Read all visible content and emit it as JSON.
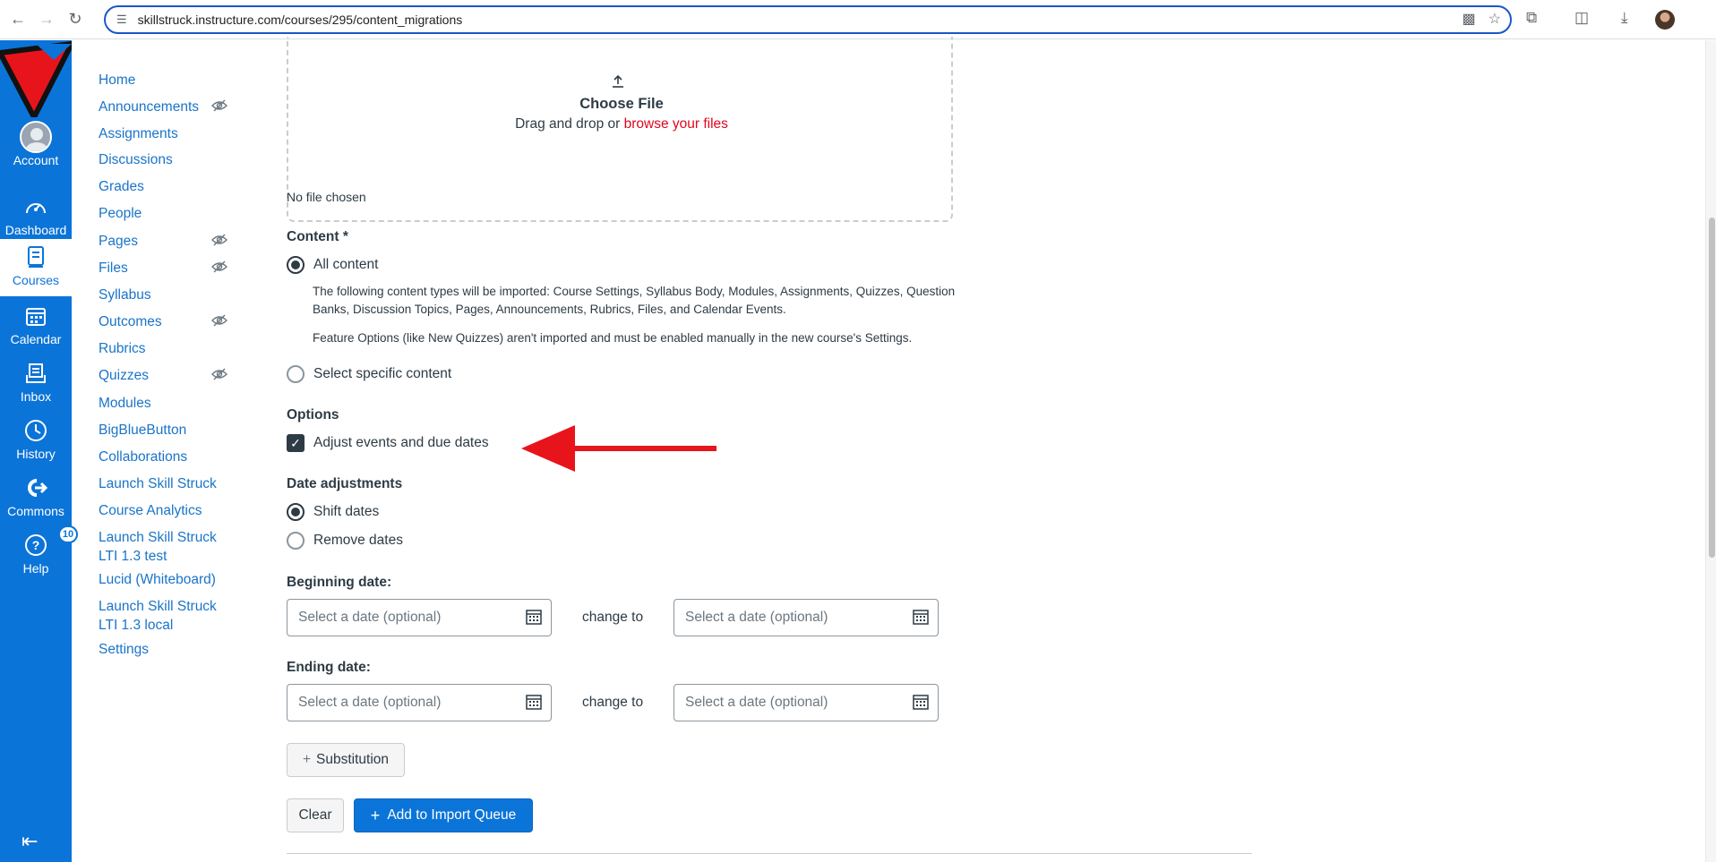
{
  "browser": {
    "url": "skillstruck.instructure.com/courses/295/content_migrations"
  },
  "global_nav": {
    "items": [
      {
        "label": "Account",
        "icon": "account-avatar"
      },
      {
        "label": "Dashboard",
        "icon": "dashboard-icon"
      },
      {
        "label": "Courses",
        "icon": "courses-icon",
        "active": true
      },
      {
        "label": "Calendar",
        "icon": "calendar-icon"
      },
      {
        "label": "Inbox",
        "icon": "inbox-icon"
      },
      {
        "label": "History",
        "icon": "history-icon"
      },
      {
        "label": "Commons",
        "icon": "commons-icon"
      },
      {
        "label": "Help",
        "icon": "help-icon",
        "badge": "10"
      }
    ],
    "accent": "#0b74d8"
  },
  "course_nav": {
    "items": [
      {
        "label": "Home",
        "hidden": false
      },
      {
        "label": "Announcements",
        "hidden": true
      },
      {
        "label": "Assignments",
        "hidden": false
      },
      {
        "label": "Discussions",
        "hidden": false
      },
      {
        "label": "Grades",
        "hidden": false
      },
      {
        "label": "People",
        "hidden": false
      },
      {
        "label": "Pages",
        "hidden": true
      },
      {
        "label": "Files",
        "hidden": true
      },
      {
        "label": "Syllabus",
        "hidden": false
      },
      {
        "label": "Outcomes",
        "hidden": true
      },
      {
        "label": "Rubrics",
        "hidden": false
      },
      {
        "label": "Quizzes",
        "hidden": true
      },
      {
        "label": "Modules",
        "hidden": false
      },
      {
        "label": "BigBlueButton",
        "hidden": false
      },
      {
        "label": "Collaborations",
        "hidden": false
      },
      {
        "label": "Launch Skill Struck",
        "hidden": false
      },
      {
        "label": "Course Analytics",
        "hidden": false
      },
      {
        "label": "Launch Skill Struck LTI 1.3 test",
        "hidden": false
      },
      {
        "label": "Lucid (Whiteboard)",
        "hidden": false
      },
      {
        "label": "Launch Skill Struck LTI 1.3 local",
        "hidden": false
      },
      {
        "label": "Settings",
        "hidden": false
      }
    ]
  },
  "upload": {
    "title": "Choose File",
    "sub_prefix": "Drag and drop or",
    "sub_link": "browse your files",
    "status": "No file chosen"
  },
  "content": {
    "label": "Content *",
    "all_content": "All content",
    "all_content_desc": "The following content types will be imported: Course Settings, Syllabus Body, Modules, Assignments, Quizzes, Question Banks, Discussion Topics, Pages, Announcements, Rubrics, Files, and Calendar Events.",
    "feature_note": "Feature Options (like New Quizzes) aren't imported and must be enabled manually in the new course's Settings.",
    "select_specific": "Select specific content"
  },
  "options": {
    "label": "Options",
    "adjust_dates": "Adjust events and due dates",
    "adjust_checked": true
  },
  "date_adjustments": {
    "label": "Date adjustments",
    "shift": "Shift dates",
    "remove": "Remove dates"
  },
  "beginning": {
    "label": "Beginning date:",
    "placeholder": "Select a date (optional)",
    "change_to": "change to"
  },
  "ending": {
    "label": "Ending date:",
    "placeholder": "Select a date (optional)",
    "change_to": "change to"
  },
  "buttons": {
    "substitution": "Substitution",
    "clear": "Clear",
    "add_queue": "Add to Import Queue"
  },
  "annotation_arrow_color": "#e8141c"
}
